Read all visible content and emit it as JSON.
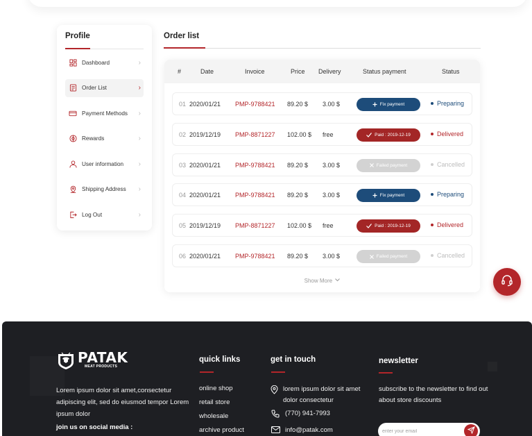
{
  "sidebar": {
    "title": "Profile",
    "items": [
      {
        "label": "Dashboard",
        "icon": "dashboard-icon",
        "active": false
      },
      {
        "label": "Order List",
        "icon": "order-list-icon",
        "active": true
      },
      {
        "label": "Payment Methods",
        "icon": "credit-card-icon",
        "active": false
      },
      {
        "label": "Rewards",
        "icon": "gift-icon",
        "active": false
      },
      {
        "label": "User information",
        "icon": "user-icon",
        "active": false
      },
      {
        "label": "Shipping Address",
        "icon": "location-pin-icon",
        "active": false
      },
      {
        "label": "Log Out",
        "icon": "logout-icon",
        "active": false
      }
    ]
  },
  "orders": {
    "tab_title": "Order list",
    "columns": [
      "#",
      "Date",
      "Invoice",
      "Price",
      "Delivery",
      "Status payment",
      "Status"
    ],
    "rows": [
      {
        "num": "01",
        "date": "2020/01/21",
        "invoice": "PMP-9788421",
        "price": "89.20 $",
        "delivery": "3.00 $",
        "payment": "Fix payment",
        "payment_kind": "fix",
        "status": "Preparing",
        "status_kind": "preparing"
      },
      {
        "num": "02",
        "date": "2019/12/19",
        "invoice": "PMP-8871227",
        "price": "102.00 $",
        "delivery": "free",
        "payment": "Paid : 2019-12-19",
        "payment_kind": "paid",
        "status": "Delivered",
        "status_kind": "delivered"
      },
      {
        "num": "03",
        "date": "2020/01/21",
        "invoice": "PMP-9788421",
        "price": "89.20 $",
        "delivery": "3.00 $",
        "payment": "Failed payment",
        "payment_kind": "failed",
        "status": "Cancelled",
        "status_kind": "cancelled"
      },
      {
        "num": "04",
        "date": "2020/01/21",
        "invoice": "PMP-9788421",
        "price": "89.20 $",
        "delivery": "3.00 $",
        "payment": "Fix payment",
        "payment_kind": "fix",
        "status": "Preparing",
        "status_kind": "preparing"
      },
      {
        "num": "05",
        "date": "2019/12/19",
        "invoice": "PMP-8871227",
        "price": "102.00 $",
        "delivery": "free",
        "payment": "Paid : 2019-12-19",
        "payment_kind": "paid",
        "status": "Delivered",
        "status_kind": "delivered"
      },
      {
        "num": "06",
        "date": "2020/01/21",
        "invoice": "PMP-9788421",
        "price": "89.20 $",
        "delivery": "3.00 $",
        "payment": "Failed payment",
        "payment_kind": "failed",
        "status": "Cancelled",
        "status_kind": "cancelled"
      }
    ],
    "show_more": "Show More"
  },
  "footer": {
    "logo_text": "PATAK",
    "logo_subtext": "MEAT PRODUCTS",
    "about": "Lorem ipsum dolor sit amet,consectetur adipiscing elit, sed do eiusmod tempor Lorem ipsum dolor",
    "social_label": "join us on social media :",
    "quick_links_title": "quick links",
    "quick_links": [
      "online shop",
      "retail store",
      "wholesale",
      "archive product"
    ],
    "contact_title": "get in touch",
    "address": "lorem ipsum dolor sit amet dolor  consectetur",
    "phone": "(770) 941-7993",
    "email": "info@patak.com",
    "newsletter_title": "newsletter",
    "newsletter_text": "subscribe to the newsletter to find out about store discounts",
    "newsletter_placeholder": "enter your email"
  },
  "colors": {
    "accent": "#b3262a",
    "navy": "#1d4c7a",
    "footer_bg": "#1e1f23"
  }
}
